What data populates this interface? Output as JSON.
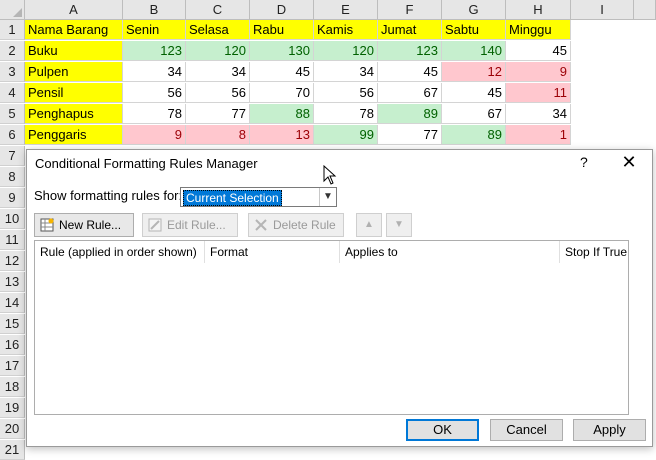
{
  "columns": [
    "A",
    "B",
    "C",
    "D",
    "E",
    "F",
    "G",
    "H",
    "I"
  ],
  "row_numbers": [
    "1",
    "2",
    "3",
    "4",
    "5",
    "6",
    "7",
    "8",
    "9",
    "10",
    "11",
    "12",
    "13",
    "14",
    "15",
    "16",
    "17",
    "18",
    "19",
    "20",
    "21"
  ],
  "table": {
    "headers": [
      "Nama Barang",
      "Senin",
      "Selasa",
      "Rabu",
      "Kamis",
      "Jumat",
      "Sabtu",
      "Minggu"
    ],
    "rows": [
      {
        "name": "Buku",
        "values": [
          "123",
          "120",
          "130",
          "120",
          "123",
          "140",
          "45"
        ]
      },
      {
        "name": "Pulpen",
        "values": [
          "34",
          "34",
          "45",
          "34",
          "45",
          "12",
          "9"
        ]
      },
      {
        "name": "Pensil",
        "values": [
          "56",
          "56",
          "70",
          "56",
          "67",
          "45",
          "11"
        ]
      },
      {
        "name": "Penghapus",
        "values": [
          "78",
          "77",
          "88",
          "78",
          "89",
          "67",
          "34"
        ]
      },
      {
        "name": "Penggaris",
        "values": [
          "9",
          "8",
          "13",
          "99",
          "77",
          "89",
          "1"
        ]
      }
    ]
  },
  "highlight_colors": {
    "green_fill": "#c6efce",
    "green_text": "#006100",
    "red_fill": "#ffc7ce",
    "red_text": "#9c0006",
    "header_fill": "#ffff00"
  },
  "dialog": {
    "title": "Conditional Formatting Rules Manager",
    "help": "?",
    "close": "✕",
    "show_label": "Show formatting rules for:",
    "show_value": "Current Selection",
    "new_rule": "New Rule...",
    "edit_rule": "Edit Rule...",
    "delete_rule": "Delete Rule",
    "columns": [
      "Rule (applied in order shown)",
      "Format",
      "Applies to",
      "Stop If True"
    ],
    "ok": "OK",
    "cancel": "Cancel",
    "apply": "Apply"
  }
}
